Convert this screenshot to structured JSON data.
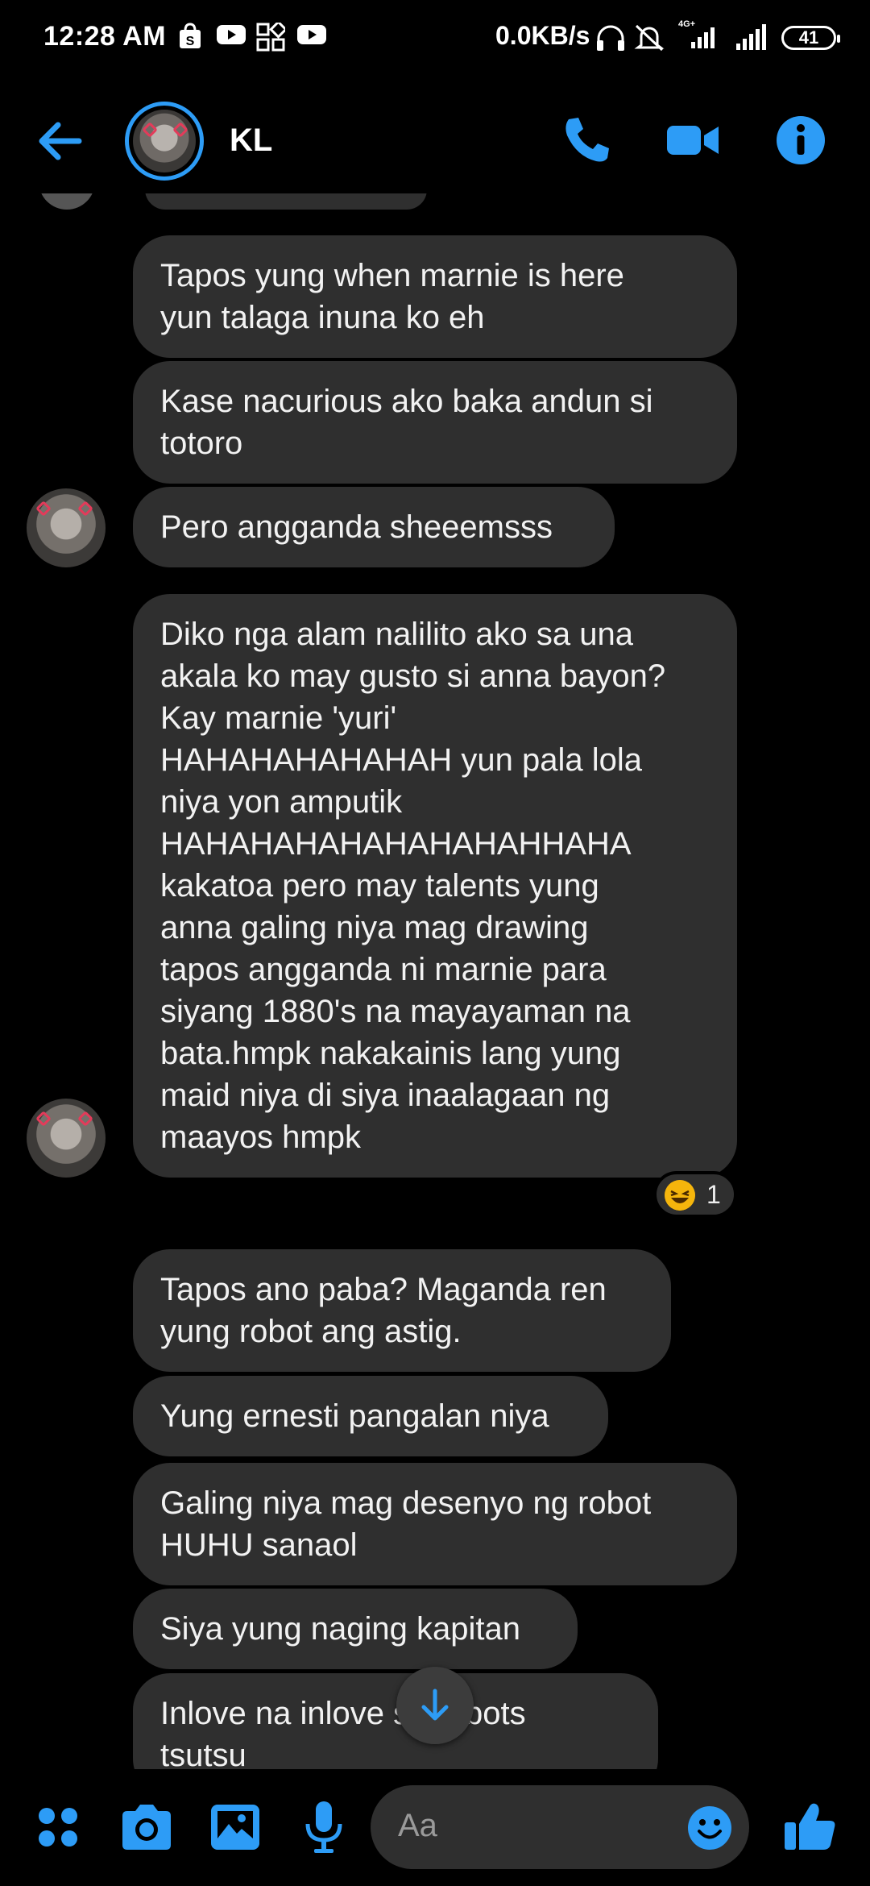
{
  "status_bar": {
    "time": "12:28 AM",
    "net_speed": "0.0KB/s",
    "network_label": "4G+",
    "battery": "41",
    "icons": [
      "shopee-icon",
      "youtube-icon",
      "app-grid-icon",
      "youtube-icon",
      "headphones-icon",
      "mute-icon",
      "signal-icon",
      "signal-icon",
      "battery-icon"
    ]
  },
  "header": {
    "contact_name": "KL",
    "icons": [
      "back-arrow-icon",
      "phone-icon",
      "video-camera-icon",
      "info-icon"
    ]
  },
  "messages": [
    {
      "text": "Tapos yung when marnie is here\nyun talaga inuna ko eh"
    },
    {
      "text": "Kase nacurious ako baka andun si\ntotoro"
    },
    {
      "text": "Pero angganda sheeemsss"
    },
    {
      "text": "Diko nga alam nalilito ako sa una\nakala ko may gusto si anna bayon?\nKay marnie 'yuri'\nHAHAHAHAHAHAH yun pala lola\nniya yon amputik\nHAHAHAHAHAHAHAHAHHAHA\nkakatoa pero may talents yung\nanna galing niya mag drawing\ntapos angganda ni marnie para\nsiyang 1880's na mayayaman na\nbata.hmpk nakakainis lang yung\nmaid niya di siya inaalagaan ng\nmaayos hmpk"
    },
    {
      "text": "Tapos ano paba? Maganda ren\nyung robot ang astig."
    },
    {
      "text": "Yung ernesti pangalan niya"
    },
    {
      "text": "Galing niya mag desenyo ng robot\nHUHU sanaol"
    },
    {
      "text": "Siya yung naging kapitan"
    },
    {
      "text": "Inlove na inlove      sa robots\ntsutsu"
    }
  ],
  "reaction": {
    "emoji": "laughing-face-emoji",
    "count": "1"
  },
  "composer": {
    "placeholder": "Aa",
    "icons": [
      "menu-dots-icon",
      "camera-icon",
      "gallery-icon",
      "microphone-icon",
      "emoji-icon",
      "thumbs-up-icon"
    ]
  },
  "colors": {
    "accent": "#2d9cf6",
    "bubble": "#2f2f2f",
    "background": "#000000"
  }
}
